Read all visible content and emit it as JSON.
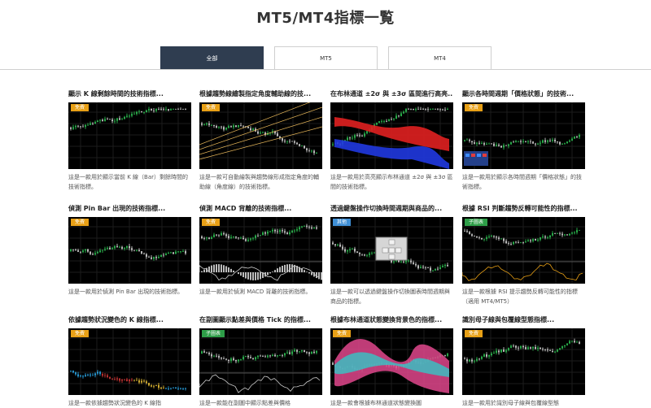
{
  "page": {
    "title": "MT5/MT4指標一覧"
  },
  "tabs": [
    {
      "label": "全部",
      "active": true
    },
    {
      "label": "MT5",
      "active": false
    },
    {
      "label": "MT4",
      "active": false
    }
  ],
  "colors": {
    "tab_active": "#2f3d50",
    "badge_orange": "#e8a016",
    "badge_green": "#2e9e48",
    "badge_blue": "#3f8fd6"
  },
  "cards": [
    {
      "title": "顯示 K 線剩餘時間的技術指標...",
      "badge": "免費",
      "badge_color": "#e8a016",
      "desc": "這是一款用於顯示當前 K 線（Bar）剩餘時間的技術指標。"
    },
    {
      "title": "根據趨勢線繪製指定角度輔助線的技...",
      "badge": "免費",
      "badge_color": "#e8a016",
      "desc": "這是一款可自動繪製與趨勢線形成指定角度的輔助線（角度線）的技術指標。"
    },
    {
      "title": "在布林通道 ±2σ 與 ±3σ 區間進行高亮...",
      "badge": "",
      "badge_color": "",
      "desc": "這是一款用於高亮顯示布林通道 ±2σ 與 ±3σ 區間的技術指標。"
    },
    {
      "title": "顯示各時間週期「價格狀態」的技術...",
      "badge": "免費",
      "badge_color": "#e8a016",
      "desc": "這是一款用於顯示各時間週期「價格狀態」的技術指標。"
    },
    {
      "title": "偵測 Pin Bar 出現的技術指標...",
      "badge": "免費",
      "badge_color": "#e8a016",
      "desc": "這是一款用於偵測 Pin Bar 出現的技術指標。"
    },
    {
      "title": "偵測 MACD 背離的技術指標...",
      "badge": "免費",
      "badge_color": "#e8a016",
      "desc": "這是一款用於偵測 MACD 背離的技術指標。"
    },
    {
      "title": "透過鍵盤操作切換時間週期與商品的...",
      "badge": "其他",
      "badge_color": "#3f8fd6",
      "desc": "這是一款可以透過鍵盤操作切換圖表時間週期與商品的指標。"
    },
    {
      "title": "根據 RSI 判斷趨勢反轉可能性的指標...",
      "badge": "子圖表",
      "badge_color": "#2e9e48",
      "desc": "這是一款根據 RSI 提示趨勢反轉可能性的指標（適用 MT4/MT5）"
    },
    {
      "title": "依據趨勢狀況變色的 K 線指標...",
      "badge": "免費",
      "badge_color": "#e8a016",
      "desc": "這是一款依據趨勢狀況變色的 K 線指"
    },
    {
      "title": "在副圖顯示點差與價格 Tick 的指標...",
      "badge": "子圖表",
      "badge_color": "#2e9e48",
      "desc": "這是一款能在副圖中顯示點差與價格"
    },
    {
      "title": "根據布林通道狀態變換背景色的指標...",
      "badge": "免費",
      "badge_color": "#e8a016",
      "desc": "這是一款會根據布林通道狀態變換圖"
    },
    {
      "title": "識別母子線與包覆線型態指標...",
      "badge": "免費",
      "badge_color": "#e8a016",
      "desc": "這是一款用於識別母子線與包覆線型態"
    }
  ]
}
